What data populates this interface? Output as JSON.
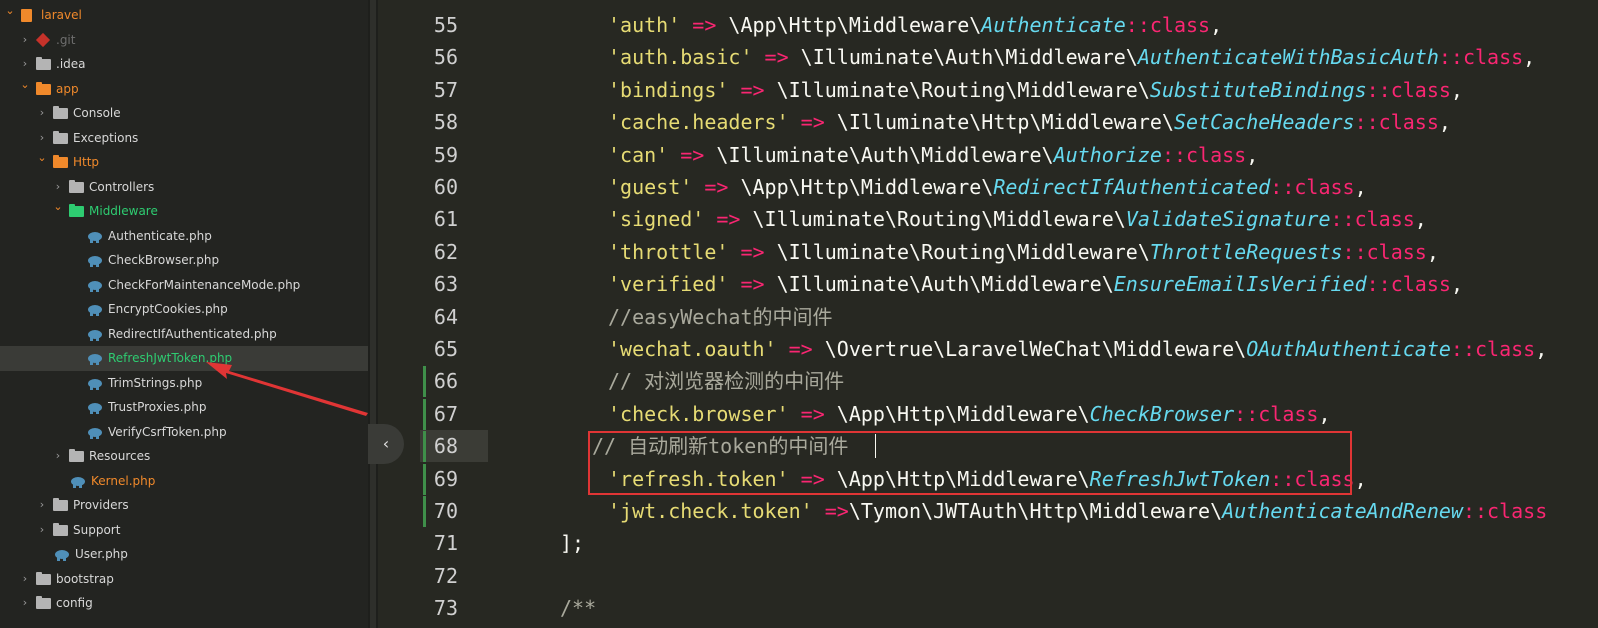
{
  "sidebar": {
    "items": [
      {
        "label": "laravel",
        "depth": 0,
        "type": "project",
        "expanded": true
      },
      {
        "label": ".git",
        "depth": 1,
        "type": "git",
        "expanded": false
      },
      {
        "label": ".idea",
        "depth": 1,
        "type": "folder",
        "expanded": false
      },
      {
        "label": "app",
        "depth": 1,
        "type": "folder-orange",
        "expanded": true
      },
      {
        "label": "Console",
        "depth": 2,
        "type": "folder",
        "expanded": false
      },
      {
        "label": "Exceptions",
        "depth": 2,
        "type": "folder",
        "expanded": false
      },
      {
        "label": "Http",
        "depth": 2,
        "type": "folder-orange",
        "expanded": true
      },
      {
        "label": "Controllers",
        "depth": 3,
        "type": "folder",
        "expanded": false
      },
      {
        "label": "Middleware",
        "depth": 3,
        "type": "folder-green",
        "expanded": true
      },
      {
        "label": "Authenticate.php",
        "depth": 4,
        "type": "php"
      },
      {
        "label": "CheckBrowser.php",
        "depth": 4,
        "type": "php"
      },
      {
        "label": "CheckForMaintenanceMode.php",
        "depth": 4,
        "type": "php"
      },
      {
        "label": "EncryptCookies.php",
        "depth": 4,
        "type": "php"
      },
      {
        "label": "RedirectIfAuthenticated.php",
        "depth": 4,
        "type": "php"
      },
      {
        "label": "RefreshJwtToken.php",
        "depth": 4,
        "type": "php",
        "selected": true
      },
      {
        "label": "TrimStrings.php",
        "depth": 4,
        "type": "php"
      },
      {
        "label": "TrustProxies.php",
        "depth": 4,
        "type": "php"
      },
      {
        "label": "VerifyCsrfToken.php",
        "depth": 4,
        "type": "php"
      },
      {
        "label": "Resources",
        "depth": 3,
        "type": "folder",
        "expanded": false
      },
      {
        "label": "Kernel.php",
        "depth": 3,
        "type": "php-orange"
      },
      {
        "label": "Providers",
        "depth": 2,
        "type": "folder",
        "expanded": false
      },
      {
        "label": "Support",
        "depth": 2,
        "type": "folder",
        "expanded": false
      },
      {
        "label": "User.php",
        "depth": 2,
        "type": "php"
      },
      {
        "label": "bootstrap",
        "depth": 1,
        "type": "folder",
        "expanded": false
      },
      {
        "label": "config",
        "depth": 1,
        "type": "folder",
        "expanded": false
      }
    ]
  },
  "editor": {
    "lines": [
      {
        "num": "55",
        "tokens": [
          [
            "s",
            "'auth'"
          ],
          [
            "p",
            " "
          ],
          [
            "k",
            "=>"
          ],
          [
            "p",
            " \\App\\Http\\Middleware\\"
          ],
          [
            "i",
            "Authenticate"
          ],
          [
            "kw",
            "::class"
          ],
          [
            "p",
            ","
          ]
        ]
      },
      {
        "num": "56",
        "tokens": [
          [
            "s",
            "'auth.basic'"
          ],
          [
            "p",
            " "
          ],
          [
            "k",
            "=>"
          ],
          [
            "p",
            " \\Illuminate\\Auth\\Middleware\\"
          ],
          [
            "i",
            "AuthenticateWithBasicAuth"
          ],
          [
            "kw",
            "::class"
          ],
          [
            "p",
            ","
          ]
        ]
      },
      {
        "num": "57",
        "tokens": [
          [
            "s",
            "'bindings'"
          ],
          [
            "p",
            " "
          ],
          [
            "k",
            "=>"
          ],
          [
            "p",
            " \\Illuminate\\Routing\\Middleware\\"
          ],
          [
            "i",
            "SubstituteBindings"
          ],
          [
            "kw",
            "::class"
          ],
          [
            "p",
            ","
          ]
        ]
      },
      {
        "num": "58",
        "tokens": [
          [
            "s",
            "'cache.headers'"
          ],
          [
            "p",
            " "
          ],
          [
            "k",
            "=>"
          ],
          [
            "p",
            " \\Illuminate\\Http\\Middleware\\"
          ],
          [
            "i",
            "SetCacheHeaders"
          ],
          [
            "kw",
            "::class"
          ],
          [
            "p",
            ","
          ]
        ]
      },
      {
        "num": "59",
        "tokens": [
          [
            "s",
            "'can'"
          ],
          [
            "p",
            " "
          ],
          [
            "k",
            "=>"
          ],
          [
            "p",
            " \\Illuminate\\Auth\\Middleware\\"
          ],
          [
            "i",
            "Authorize"
          ],
          [
            "kw",
            "::class"
          ],
          [
            "p",
            ","
          ]
        ]
      },
      {
        "num": "60",
        "tokens": [
          [
            "s",
            "'guest'"
          ],
          [
            "p",
            " "
          ],
          [
            "k",
            "=>"
          ],
          [
            "p",
            " \\App\\Http\\Middleware\\"
          ],
          [
            "i",
            "RedirectIfAuthenticated"
          ],
          [
            "kw",
            "::class"
          ],
          [
            "p",
            ","
          ]
        ]
      },
      {
        "num": "61",
        "tokens": [
          [
            "s",
            "'signed'"
          ],
          [
            "p",
            " "
          ],
          [
            "k",
            "=>"
          ],
          [
            "p",
            " \\Illuminate\\Routing\\Middleware\\"
          ],
          [
            "i",
            "ValidateSignature"
          ],
          [
            "kw",
            "::class"
          ],
          [
            "p",
            ","
          ]
        ]
      },
      {
        "num": "62",
        "tokens": [
          [
            "s",
            "'throttle'"
          ],
          [
            "p",
            " "
          ],
          [
            "k",
            "=>"
          ],
          [
            "p",
            " \\Illuminate\\Routing\\Middleware\\"
          ],
          [
            "i",
            "ThrottleRequests"
          ],
          [
            "kw",
            "::class"
          ],
          [
            "p",
            ","
          ]
        ]
      },
      {
        "num": "63",
        "tokens": [
          [
            "s",
            "'verified'"
          ],
          [
            "p",
            " "
          ],
          [
            "k",
            "=>"
          ],
          [
            "p",
            " \\Illuminate\\Auth\\Middleware\\"
          ],
          [
            "i",
            "EnsureEmailIsVerified"
          ],
          [
            "kw",
            "::class"
          ],
          [
            "p",
            ","
          ]
        ]
      },
      {
        "num": "64",
        "tokens": [
          [
            "c2",
            "//easyWechat的中间件"
          ]
        ]
      },
      {
        "num": "65",
        "tokens": [
          [
            "s",
            "'wechat.oauth'"
          ],
          [
            "p",
            " "
          ],
          [
            "k",
            "=>"
          ],
          [
            "p",
            " \\Overtrue\\LaravelWeChat\\Middleware\\"
          ],
          [
            "i",
            "OAuthAuthenticate"
          ],
          [
            "kw",
            "::class"
          ],
          [
            "p",
            ","
          ]
        ]
      },
      {
        "num": "66",
        "tokens": [
          [
            "c2",
            "// 对浏览器检测的中间件"
          ]
        ]
      },
      {
        "num": "67",
        "tokens": [
          [
            "s",
            "'check.browser'"
          ],
          [
            "p",
            " "
          ],
          [
            "k",
            "=>"
          ],
          [
            "p",
            " \\App\\Http\\Middleware\\"
          ],
          [
            "i",
            "CheckBrowser"
          ],
          [
            "kw",
            "::class"
          ],
          [
            "p",
            ","
          ]
        ]
      },
      {
        "num": "68",
        "tokens": [
          [
            "c2",
            "// 自动刷新token的中间件"
          ]
        ]
      },
      {
        "num": "69",
        "tokens": [
          [
            "s",
            "'refresh.token'"
          ],
          [
            "p",
            " "
          ],
          [
            "k",
            "=>"
          ],
          [
            "p",
            " \\App\\Http\\Middleware\\"
          ],
          [
            "i",
            "RefreshJwtToken"
          ],
          [
            "kw",
            "::class"
          ],
          [
            "p",
            ","
          ]
        ]
      },
      {
        "num": "70",
        "tokens": [
          [
            "s",
            "'jwt.check.token'"
          ],
          [
            "p",
            " "
          ],
          [
            "k",
            "=>"
          ],
          [
            "p",
            "\\Tymon\\JWTAuth\\Http\\Middleware\\"
          ],
          [
            "i",
            "AuthenticateAndRenew"
          ],
          [
            "kw",
            "::class"
          ]
        ]
      },
      {
        "num": "71",
        "tokens": [
          [
            "p",
            "];"
          ]
        ]
      },
      {
        "num": "72",
        "tokens": []
      },
      {
        "num": "73",
        "tokens": [
          [
            "c2",
            "/**"
          ]
        ]
      }
    ]
  },
  "colors": {
    "background": "#272822",
    "sidebar": "#232421",
    "string": "#e6db74",
    "operator": "#f92672",
    "class_name": "#66d9ef",
    "comment": "#a9a99c",
    "annotation_red": "#e03535"
  },
  "icons": {
    "collapse": "chevron-left-icon"
  }
}
